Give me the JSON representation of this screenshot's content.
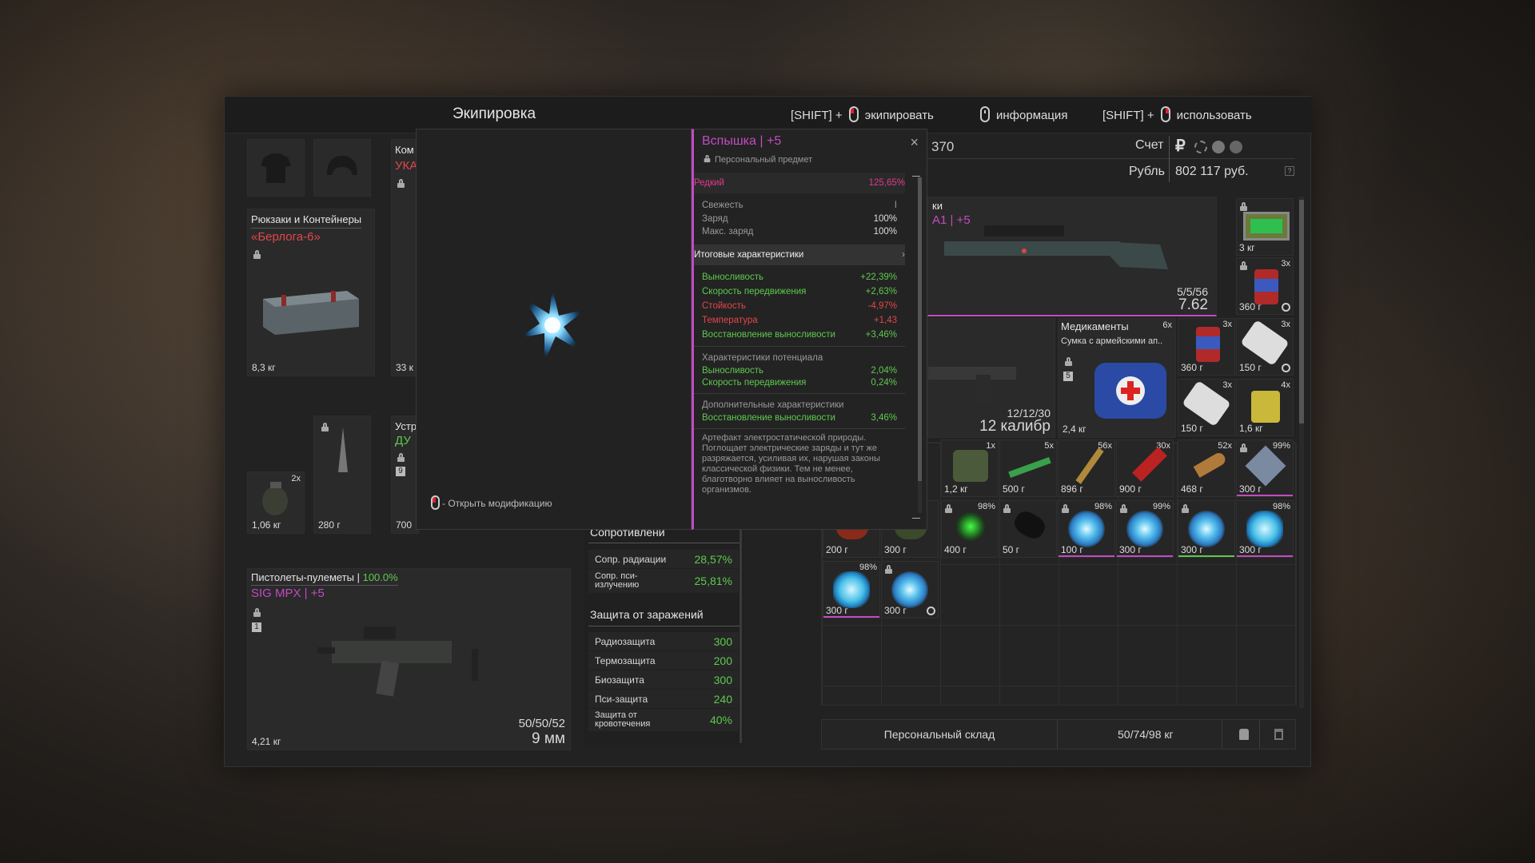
{
  "window": {
    "title": "Экипировка",
    "hints": [
      {
        "prefix": "[SHIFT] +",
        "label": "экипировать"
      },
      {
        "prefix": "",
        "label": "информация"
      },
      {
        "prefix": "[SHIFT] +",
        "label": "использовать"
      }
    ]
  },
  "equipment": {
    "backpack": {
      "category": "Рюкзаки и Контейнеры",
      "name": "«Берлога-6»",
      "weight": "8,3 кг"
    },
    "slot2": {
      "header": "Ком",
      "sub": "УКА",
      "weight": "33 к"
    },
    "grenade": {
      "count": "2x",
      "weight": "1,06 кг"
    },
    "knife": {
      "weight": "280 г"
    },
    "device": {
      "header": "Устр",
      "sub": "ДУ",
      "badge": "9",
      "weight": "700"
    },
    "smg": {
      "category": "Пистолеты-пулеметы",
      "durability": "100.0%",
      "name": "SIG MPX | +5",
      "badge": "1",
      "weight": "4,21 кг",
      "ammo": "50/50/52",
      "caliber": "9 мм"
    }
  },
  "resist": {
    "header": "Сопротивлени",
    "rows": [
      {
        "label": "Сопр. радиации",
        "value": "28,57%"
      },
      {
        "label": "Сопр. пси-излучению",
        "value": "25,81%"
      }
    ]
  },
  "protection": {
    "header": "Защита от заражений",
    "rows": [
      {
        "label": "Радиозащита",
        "value": "300"
      },
      {
        "label": "Термозащита",
        "value": "200"
      },
      {
        "label": "Биозащита",
        "value": "300"
      },
      {
        "label": "Пси-защита",
        "value": "240"
      },
      {
        "label": "Защита от кровотечения",
        "value": "40%"
      }
    ]
  },
  "popup": {
    "open_mod": "- Открыть модификацию",
    "name": "Вспышка | +5",
    "personal": "Персональный предмет",
    "rarity": "Редкий",
    "rarity_value": "125,65%",
    "freshness_label": "Свежесть",
    "freshness_value": "I",
    "charge_label": "Заряд",
    "charge_value": "100%",
    "maxcharge_label": "Макс. заряд",
    "maxcharge_value": "100%",
    "summary_header": "Итоговые характеристики",
    "summary": [
      {
        "label": "Выносливость",
        "value": "+22,39%",
        "color": "#5ec94e"
      },
      {
        "label": "Скорость передвижения",
        "value": "+2,63%",
        "color": "#5ec94e"
      },
      {
        "label": "Стойкость",
        "value": "-4,97%",
        "color": "#e2464a"
      },
      {
        "label": "Температура",
        "value": "+1,43",
        "color": "#e2464a"
      },
      {
        "label": "Восстановление выносливости",
        "value": "+3,46%",
        "color": "#5ec94e"
      }
    ],
    "potential_header": "Характеристики потенциала",
    "potential": [
      {
        "label": "Выносливость",
        "value": "2,04%"
      },
      {
        "label": "Скорость передвижения",
        "value": "0,24%"
      }
    ],
    "extra_header": "Дополнительные характеристики",
    "extra": [
      {
        "label": "Восстановление выносливости",
        "value": "3,46%"
      }
    ],
    "description": "Артефакт электростатической природы. Поглощает электрические заряды и тут же разряжается, усиливая их, нарушая законы классической физики. Тем не менее, благотворно влияет на выносливость организмов."
  },
  "account": {
    "partial": "370",
    "label": "Счет",
    "currency_symbol": "₽",
    "currency_label": "Рубль",
    "amount": "802 117 руб."
  },
  "weapon": {
    "partial_header": "ки",
    "partial_name": "А1 | +5",
    "ammo": "5/5/56",
    "caliber": "7.62"
  },
  "shotgun": {
    "ammo": "12/12/30",
    "caliber": "12 калибр"
  },
  "medkit": {
    "header": "Медикаменты",
    "count": "6x",
    "name": "Сумка с армейскими ап..",
    "badge": "5",
    "weight": "2,4 кг"
  },
  "grid": [
    {
      "w": "3 кг",
      "c": ""
    },
    {
      "w": "360 г",
      "c": "3x"
    },
    {
      "w": "360 г",
      "c": "3x"
    },
    {
      "w": "150 г",
      "c": "3x"
    },
    {
      "w": "150 г",
      "c": "3x"
    },
    {
      "w": "1,6 кг",
      "c": "4x"
    },
    {
      "w": "1,2 кг",
      "c": "1x"
    },
    {
      "w": "500 г",
      "c": "5x"
    },
    {
      "w": "896 г",
      "c": "56x"
    },
    {
      "w": "900 г",
      "c": "30x"
    },
    {
      "w": "468 г",
      "c": "52x"
    },
    {
      "w": "300 г",
      "c": "99%"
    },
    {
      "w": "200 г",
      "c": ""
    },
    {
      "w": "300 г",
      "c": ""
    },
    {
      "w": "400 г",
      "c": "98%"
    },
    {
      "w": "50 г",
      "c": ""
    },
    {
      "w": "100 г",
      "c": "98%"
    },
    {
      "w": "300 г",
      "c": "99%"
    },
    {
      "w": "300 г",
      "c": ""
    },
    {
      "w": "300 г",
      "c": "98%"
    },
    {
      "w": "300 г",
      "c": "98%"
    },
    {
      "w": "300 г",
      "c": ""
    }
  ],
  "storage": {
    "label": "Персональный склад",
    "weight": "50/74/98 кг"
  },
  "colors": {
    "accent_pink": "#e23a8f",
    "green": "#5ec94e",
    "red": "#e2464a",
    "purple_border": "#c24bc2"
  }
}
